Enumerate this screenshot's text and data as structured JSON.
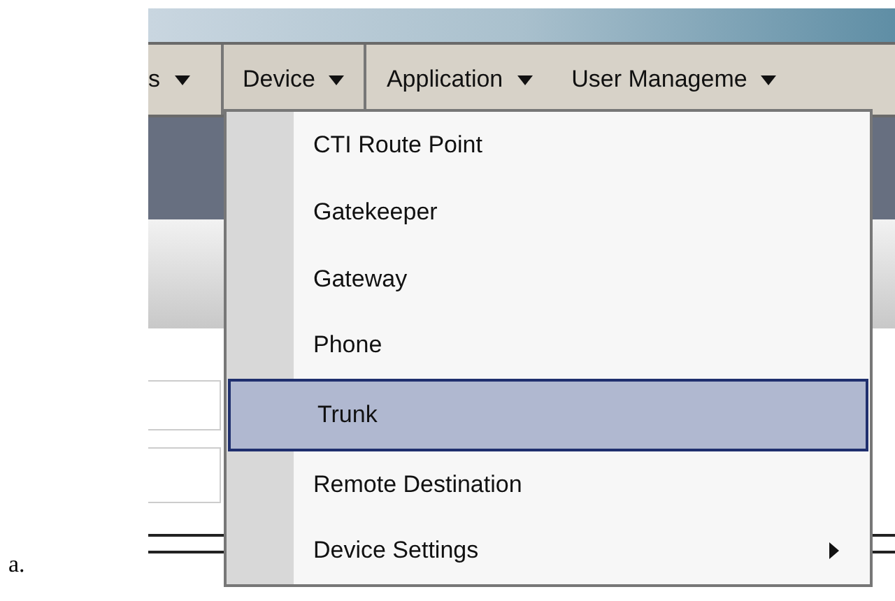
{
  "label": "a.",
  "menubar": [
    {
      "label": "s",
      "selected": false
    },
    {
      "label": "Device",
      "selected": true
    },
    {
      "label": "Application",
      "selected": false
    },
    {
      "label": "User Manageme",
      "selected": false
    }
  ],
  "menu": [
    {
      "label": "CTI Route Point",
      "kind": "item",
      "selected": false
    },
    {
      "label": "Gatekeeper",
      "kind": "item",
      "selected": false
    },
    {
      "label": "Gateway",
      "kind": "item",
      "selected": false
    },
    {
      "label": "Phone",
      "kind": "item",
      "selected": false
    },
    {
      "label": "Trunk",
      "kind": "item",
      "selected": true
    },
    {
      "label": "Remote Destination",
      "kind": "item",
      "selected": false
    },
    {
      "label": "Device Settings",
      "kind": "submenu",
      "selected": false
    }
  ]
}
